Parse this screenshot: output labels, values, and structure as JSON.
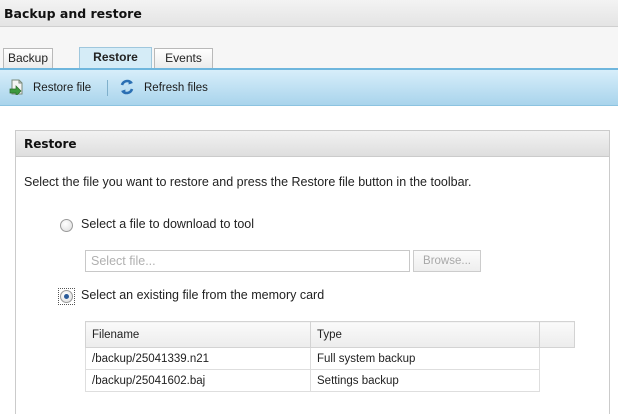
{
  "window": {
    "title": "Backup and restore"
  },
  "tabs": [
    {
      "label": "Backup",
      "active": false
    },
    {
      "label": "Restore",
      "active": true
    },
    {
      "label": "Events",
      "active": false
    }
  ],
  "toolbar": {
    "restore_file_label": "Restore file",
    "refresh_files_label": "Refresh files",
    "restore_icon": "restore-file-icon",
    "refresh_icon": "refresh-icon"
  },
  "panel": {
    "title": "Restore",
    "instruction": "Select the file you want to restore and press the Restore file button in the toolbar."
  },
  "options": {
    "download": {
      "label": "Select a file to download to tool",
      "checked": false
    },
    "memory_card": {
      "label": "Select an existing file from the memory card",
      "checked": true
    }
  },
  "file_select": {
    "placeholder": "Select file...",
    "value": "",
    "browse_label": "Browse..."
  },
  "table": {
    "columns": [
      "Filename",
      "Type"
    ],
    "rows": [
      {
        "filename": "/backup/25041339.n21",
        "type": "Full system backup"
      },
      {
        "filename": "/backup/25041602.baj",
        "type": "Settings backup"
      }
    ]
  },
  "colors": {
    "toolbar_accent": "#a9d4ec",
    "active_tab": "#d5ecf7",
    "restore_icon_green": "#3e9a3e",
    "refresh_icon_blue": "#2a6fb3"
  }
}
